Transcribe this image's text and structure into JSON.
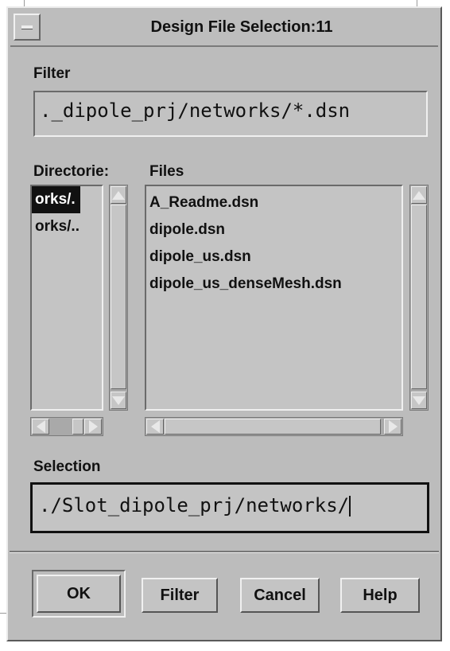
{
  "window": {
    "title": "Design File Selection:11"
  },
  "filter": {
    "label": "Filter",
    "value": "_dipole_prj/networks/*.dsn",
    "prefix": "."
  },
  "directories": {
    "label": "Directorie:",
    "items": [
      {
        "label": "orks/.",
        "selected": true
      },
      {
        "label": "orks/..",
        "selected": false
      }
    ]
  },
  "files": {
    "label": "Files",
    "items": [
      "A_Readme.dsn",
      "dipole.dsn",
      "dipole_us.dsn",
      "dipole_us_denseMesh.dsn"
    ]
  },
  "selection": {
    "label": "Selection",
    "value": "./Slot_dipole_prj/networks/"
  },
  "buttons": {
    "ok": "OK",
    "filter": "Filter",
    "cancel": "Cancel",
    "help": "Help"
  },
  "colors": {
    "background": "#bcbcbc",
    "selected_bg": "#111111",
    "selected_fg": "#ffffff"
  }
}
